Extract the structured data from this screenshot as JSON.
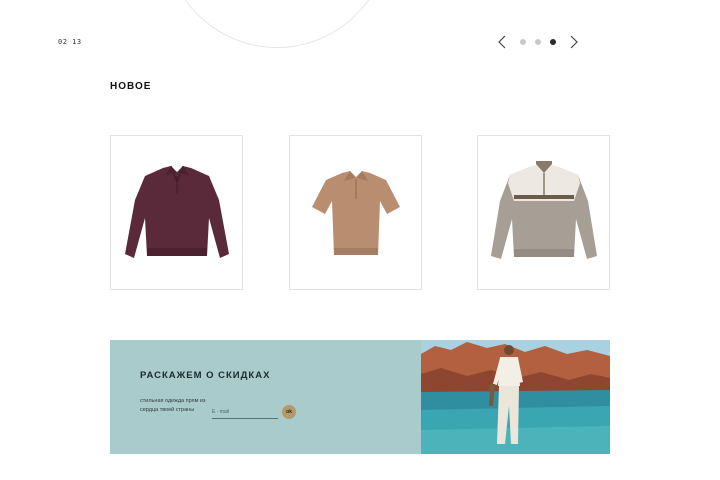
{
  "slider": {
    "counter": "02 13",
    "prev_icon": "chevron-left-icon",
    "next_icon": "chevron-right-icon",
    "dots_count": 3,
    "active_dot": 3
  },
  "section": {
    "title": "НОВОЕ"
  },
  "products": [
    {
      "name": "burgundy-knit-polo",
      "color": "#5b2a3a"
    },
    {
      "name": "tan-knit-polo",
      "color": "#b98d70"
    },
    {
      "name": "grey-zip-knit-sweater",
      "color": "#a79e95"
    }
  ],
  "banner": {
    "title": "РАСКАЖЕМ О СКИДКАХ",
    "text": "стильная одежда прям из сердца твоей страны",
    "email_placeholder": "E - mail",
    "submit_label": "ok",
    "background_color": "#a9cbcc",
    "button_color": "#b39a68"
  },
  "colors": {
    "dot_inactive": "#c9c9c9",
    "dot_active": "#2b2b2b"
  }
}
